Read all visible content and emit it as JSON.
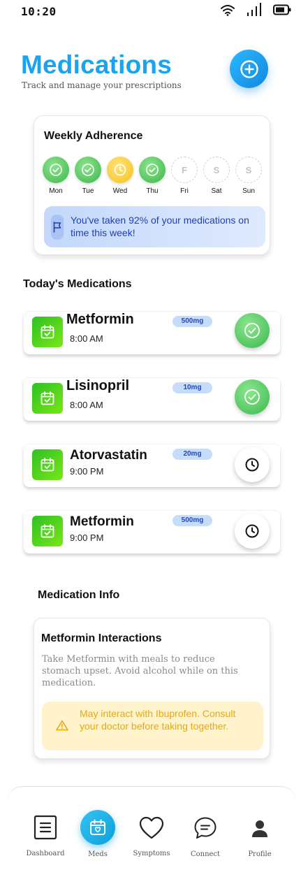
{
  "status_bar": {
    "time": "10:20"
  },
  "header": {
    "title": "Medications",
    "subtitle": "Track and manage your prescriptions"
  },
  "weekly": {
    "title": "Weekly Adherence",
    "days": [
      {
        "label": "Mon",
        "status": "taken",
        "letter": ""
      },
      {
        "label": "Tue",
        "status": "taken",
        "letter": ""
      },
      {
        "label": "Wed",
        "status": "partial",
        "letter": ""
      },
      {
        "label": "Thu",
        "status": "taken",
        "letter": ""
      },
      {
        "label": "Fri",
        "status": "upcoming",
        "letter": "F"
      },
      {
        "label": "Sat",
        "status": "upcoming",
        "letter": "S"
      },
      {
        "label": "Sun",
        "status": "upcoming",
        "letter": "S"
      }
    ],
    "banner": "You've taken 92% of your medications on time this week!"
  },
  "today": {
    "title": "Today's Medications",
    "meds": [
      {
        "name": "Metformin",
        "time": "8:00 AM",
        "dose": "500mg",
        "status": "taken"
      },
      {
        "name": "Lisinopril",
        "time": "8:00 AM",
        "dose": "10mg",
        "status": "taken"
      },
      {
        "name": "Atorvastatin",
        "time": "9:00 PM",
        "dose": "20mg",
        "status": "pending"
      },
      {
        "name": "Metformin",
        "time": "9:00 PM",
        "dose": "500mg",
        "status": "pending"
      }
    ]
  },
  "info": {
    "section_title": "Medication Info",
    "card_title": "Metformin Interactions",
    "text": "Take Metformin with meals to reduce stomach upset. Avoid alcohol while on this medication.",
    "warning": "May interact with Ibuprofen. Consult your doctor before taking together."
  },
  "nav": {
    "items": [
      {
        "label": "Dashboard",
        "icon": "document-icon",
        "active": false
      },
      {
        "label": "Meds",
        "icon": "calendar-heart-icon",
        "active": true
      },
      {
        "label": "Symptoms",
        "icon": "heart-icon",
        "active": false
      },
      {
        "label": "Connect",
        "icon": "chat-icon",
        "active": false
      },
      {
        "label": "Profile",
        "icon": "user-icon",
        "active": false
      }
    ]
  },
  "colors": {
    "accent_blue": "#1aa4f0",
    "taken_green": "#3cb84a",
    "partial_yellow": "#f7c21c",
    "badge_bg": "#c6dcfb",
    "warning_text": "#e6a90f"
  }
}
